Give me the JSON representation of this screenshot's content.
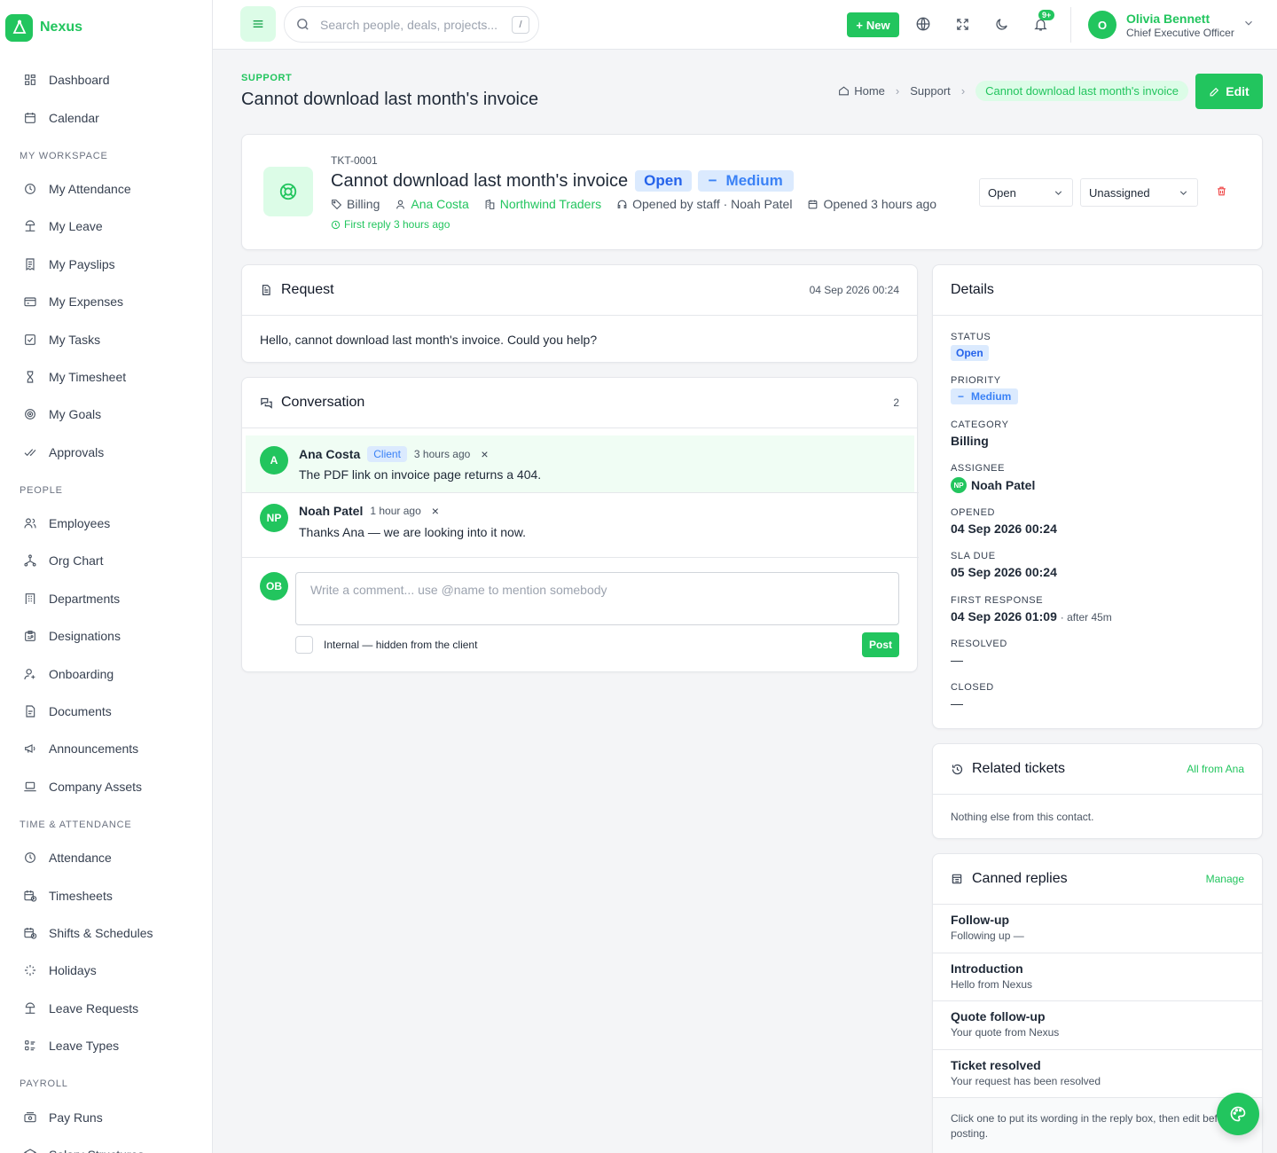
{
  "brand": {
    "name": "Nexus",
    "accent": "#22c55e"
  },
  "sidebar": {
    "top": [
      {
        "label": "Dashboard",
        "icon": "dashboard-icon"
      },
      {
        "label": "Calendar",
        "icon": "calendar-icon"
      }
    ],
    "sections": [
      {
        "title": "MY WORKSPACE",
        "items": [
          {
            "label": "My Attendance",
            "icon": "clock-icon"
          },
          {
            "label": "My Leave",
            "icon": "beach-icon"
          },
          {
            "label": "My Payslips",
            "icon": "receipt-icon"
          },
          {
            "label": "My Expenses",
            "icon": "card-icon"
          },
          {
            "label": "My Tasks",
            "icon": "task-check-icon"
          },
          {
            "label": "My Timesheet",
            "icon": "hourglass-icon"
          },
          {
            "label": "My Goals",
            "icon": "target-icon"
          },
          {
            "label": "Approvals",
            "icon": "double-check-icon"
          }
        ]
      },
      {
        "title": "PEOPLE",
        "items": [
          {
            "label": "Employees",
            "icon": "users-icon"
          },
          {
            "label": "Org Chart",
            "icon": "org-chart-icon"
          },
          {
            "label": "Departments",
            "icon": "building-icon"
          },
          {
            "label": "Designations",
            "icon": "badge-icon"
          },
          {
            "label": "Onboarding",
            "icon": "user-plus-icon"
          },
          {
            "label": "Documents",
            "icon": "document-icon"
          },
          {
            "label": "Announcements",
            "icon": "megaphone-icon"
          },
          {
            "label": "Company Assets",
            "icon": "laptop-icon"
          }
        ]
      },
      {
        "title": "TIME & ATTENDANCE",
        "items": [
          {
            "label": "Attendance",
            "icon": "clock-icon"
          },
          {
            "label": "Timesheets",
            "icon": "calendar-clock-icon"
          },
          {
            "label": "Shifts & Schedules",
            "icon": "calendar-time-icon"
          },
          {
            "label": "Holidays",
            "icon": "sparkle-icon"
          },
          {
            "label": "Leave Requests",
            "icon": "beach-icon"
          },
          {
            "label": "Leave Types",
            "icon": "list-icon"
          }
        ]
      },
      {
        "title": "PAYROLL",
        "items": [
          {
            "label": "Pay Runs",
            "icon": "cash-icon"
          },
          {
            "label": "Salary Structures",
            "icon": "layers-icon"
          }
        ]
      }
    ]
  },
  "topbar": {
    "search_placeholder": "Search people, deals, projects...",
    "search_shortcut": "/",
    "new_label": "New",
    "notifications_badge": "9+",
    "user": {
      "initial": "O",
      "name": "Olivia Bennett",
      "role": "Chief Executive Officer"
    }
  },
  "page": {
    "eyebrow": "SUPPORT",
    "title": "Cannot download last month's invoice",
    "breadcrumb": {
      "home": "Home",
      "section": "Support",
      "current": "Cannot download last month's invoice"
    },
    "edit_label": "Edit"
  },
  "ticket": {
    "id": "TKT-0001",
    "title": "Cannot download last month's invoice",
    "status": "Open",
    "priority": "Medium",
    "category": "Billing",
    "contact": "Ana Costa",
    "company": "Northwind Traders",
    "opened_by": "Opened by staff · Noah Patel",
    "opened": "Opened 3 hours ago",
    "first_reply": "First reply 3 hours ago",
    "status_select": "Open",
    "assignee_select": "Unassigned"
  },
  "request": {
    "title": "Request",
    "date": "04 Sep 2026 00:24",
    "body": "Hello, cannot download last month's invoice. Could you help?"
  },
  "conversation": {
    "title": "Conversation",
    "count": "2",
    "messages": [
      {
        "initials": "A",
        "name": "Ana Costa",
        "tag": "Client",
        "time": "3 hours ago",
        "text": "The PDF link on invoice page returns a 404."
      },
      {
        "initials": "NP",
        "name": "Noah Patel",
        "time": "1 hour ago",
        "text": "Thanks Ana — we are looking into it now."
      }
    ],
    "composer": {
      "initials": "OB",
      "placeholder": "Write a comment... use @name to mention somebody",
      "internal_label": "Internal — hidden from the client",
      "post_label": "Post"
    }
  },
  "details": {
    "title": "Details",
    "status_label": "STATUS",
    "status": "Open",
    "priority_label": "PRIORITY",
    "priority": "Medium",
    "category_label": "CATEGORY",
    "category": "Billing",
    "assignee_label": "ASSIGNEE",
    "assignee_initials": "NP",
    "assignee": "Noah Patel",
    "opened_label": "OPENED",
    "opened": "04 Sep 2026 00:24",
    "sla_label": "SLA DUE",
    "sla": "05 Sep 2026 00:24",
    "first_response_label": "FIRST RESPONSE",
    "first_response": "04 Sep 2026 01:09",
    "first_response_note": "· after 45m",
    "resolved_label": "RESOLVED",
    "resolved": "—",
    "closed_label": "CLOSED",
    "closed": "—"
  },
  "related": {
    "title": "Related tickets",
    "link": "All from Ana",
    "empty": "Nothing else from this contact."
  },
  "canned": {
    "title": "Canned replies",
    "link": "Manage",
    "items": [
      {
        "title": "Follow-up",
        "sub": "Following up —"
      },
      {
        "title": "Introduction",
        "sub": "Hello from Nexus"
      },
      {
        "title": "Quote follow-up",
        "sub": "Your quote from Nexus"
      },
      {
        "title": "Ticket resolved",
        "sub": "Your request has been resolved"
      }
    ],
    "hint": "Click one to put its wording in the reply box, then edit before posting."
  }
}
